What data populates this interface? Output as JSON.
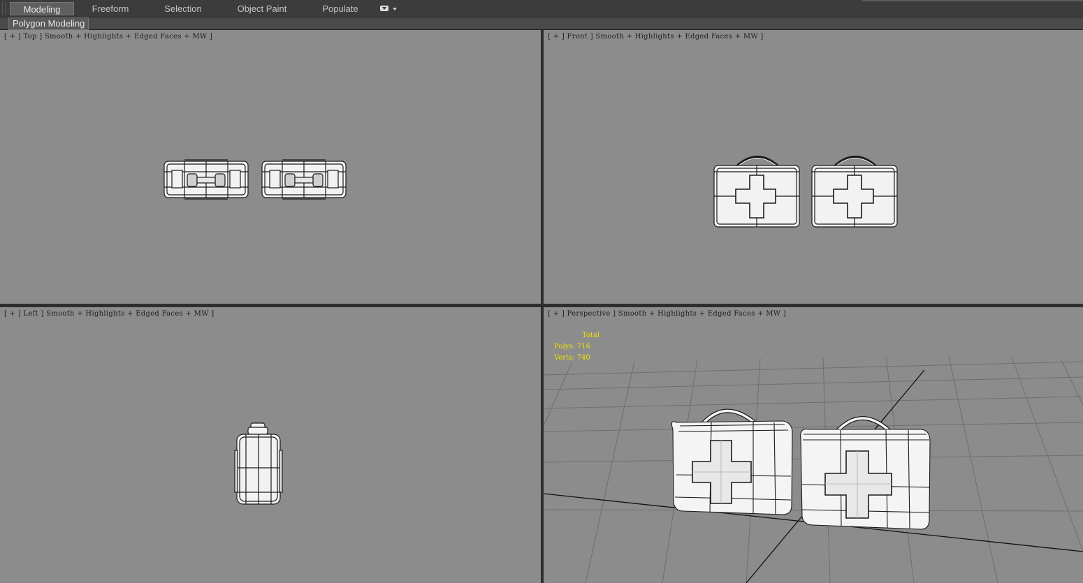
{
  "ribbon": {
    "tabs": [
      {
        "label": "Modeling",
        "active": true
      },
      {
        "label": "Freeform",
        "active": false
      },
      {
        "label": "Selection",
        "active": false
      },
      {
        "label": "Object Paint",
        "active": false
      },
      {
        "label": "Populate",
        "active": false
      }
    ],
    "options_icon": "ribbon-options-dropdown-icon",
    "panel_label": "Polygon Modeling"
  },
  "viewports": {
    "top": {
      "label": "[ + ] Top ] Smooth + Highlights + Edged Faces + MW ]"
    },
    "front": {
      "label": "[ + ] Front ] Smooth + Highlights + Edged Faces + MW ]"
    },
    "left": {
      "label": "[ + ] Left ] Smooth + Highlights + Edged Faces + MW ]"
    },
    "perspective": {
      "label": "[ + ] Perspective ] Smooth + Highlights + Edged Faces + MW ]",
      "stats": {
        "header": "Total",
        "polys": "Polys: 716",
        "verts": "Verts: 740"
      }
    }
  },
  "colors": {
    "viewport_bg": "#8c8c8c",
    "stats_text": "#f0e000",
    "ribbon_bg": "#3c3c3c",
    "model_fill": "#f2f2f2",
    "wire": "#1a1a1a"
  }
}
